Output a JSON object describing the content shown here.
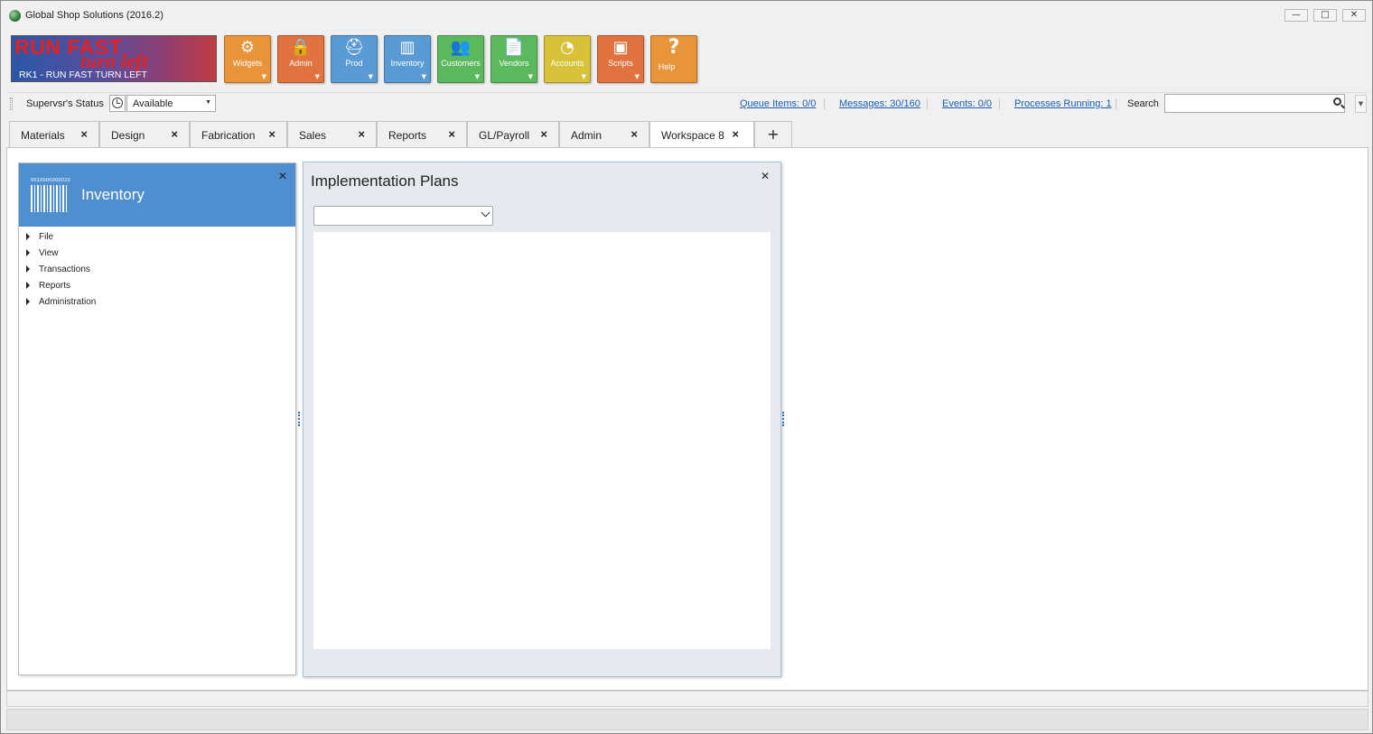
{
  "window": {
    "title": "Global Shop Solutions (2016.2)",
    "controls": {
      "minimize": "—",
      "maximize": "□",
      "close": "✕"
    }
  },
  "logo": {
    "main_text": "RUN FAST",
    "script_text": "turn left",
    "subtitle": "RK1 - RUN FAST TURN LEFT"
  },
  "ribbon": {
    "tiles": [
      {
        "label": "Widgets",
        "icon": "gear-icon",
        "glyph": "⚙",
        "color": "#e8943a"
      },
      {
        "label": "Admin",
        "icon": "lock-icon",
        "glyph": "🔒",
        "color": "#e0733f"
      },
      {
        "label": "Prod",
        "icon": "hardhat-icon",
        "glyph": "⛑",
        "color": "#5b9bd5"
      },
      {
        "label": "Inventory",
        "icon": "barcode-icon",
        "glyph": "▥",
        "color": "#5b9bd5"
      },
      {
        "label": "Customers",
        "icon": "people-icon",
        "glyph": "👥",
        "color": "#5cb85c"
      },
      {
        "label": "Vendors",
        "icon": "document-icon",
        "glyph": "📄",
        "color": "#5cb85c"
      },
      {
        "label": "Accounts",
        "icon": "pie-chart-icon",
        "glyph": "◔",
        "color": "#d8c23a"
      },
      {
        "label": "Scripts",
        "icon": "script-icon",
        "glyph": "▣",
        "color": "#e0733f"
      },
      {
        "label": "Help",
        "icon": "question-icon",
        "glyph": "?",
        "color": "#e8943a"
      }
    ]
  },
  "status_bar": {
    "label": "Supervsr's Status",
    "status_value": "Available",
    "links": {
      "queue": "Queue Items: 0/0",
      "messages": "Messages: 30/160",
      "events": "Events: 0/0",
      "processes": "Processes Running: 1"
    },
    "search_label": "Search",
    "search_value": ""
  },
  "tabs": [
    {
      "label": "Materials"
    },
    {
      "label": "Design"
    },
    {
      "label": "Fabrication"
    },
    {
      "label": "Sales"
    },
    {
      "label": "Reports"
    },
    {
      "label": "GL/Payroll"
    },
    {
      "label": "Admin"
    },
    {
      "label": "Workspace 8",
      "active": true
    }
  ],
  "tab_add_label": "+",
  "nav_panel": {
    "title": "Inventory",
    "barcode_number": "0010000000020",
    "close": "✕",
    "tree": [
      "File",
      "View",
      "Transactions",
      "Reports",
      "Administration"
    ]
  },
  "impl_panel": {
    "title": "Implementation Plans",
    "close": "✕",
    "select_value": ""
  }
}
